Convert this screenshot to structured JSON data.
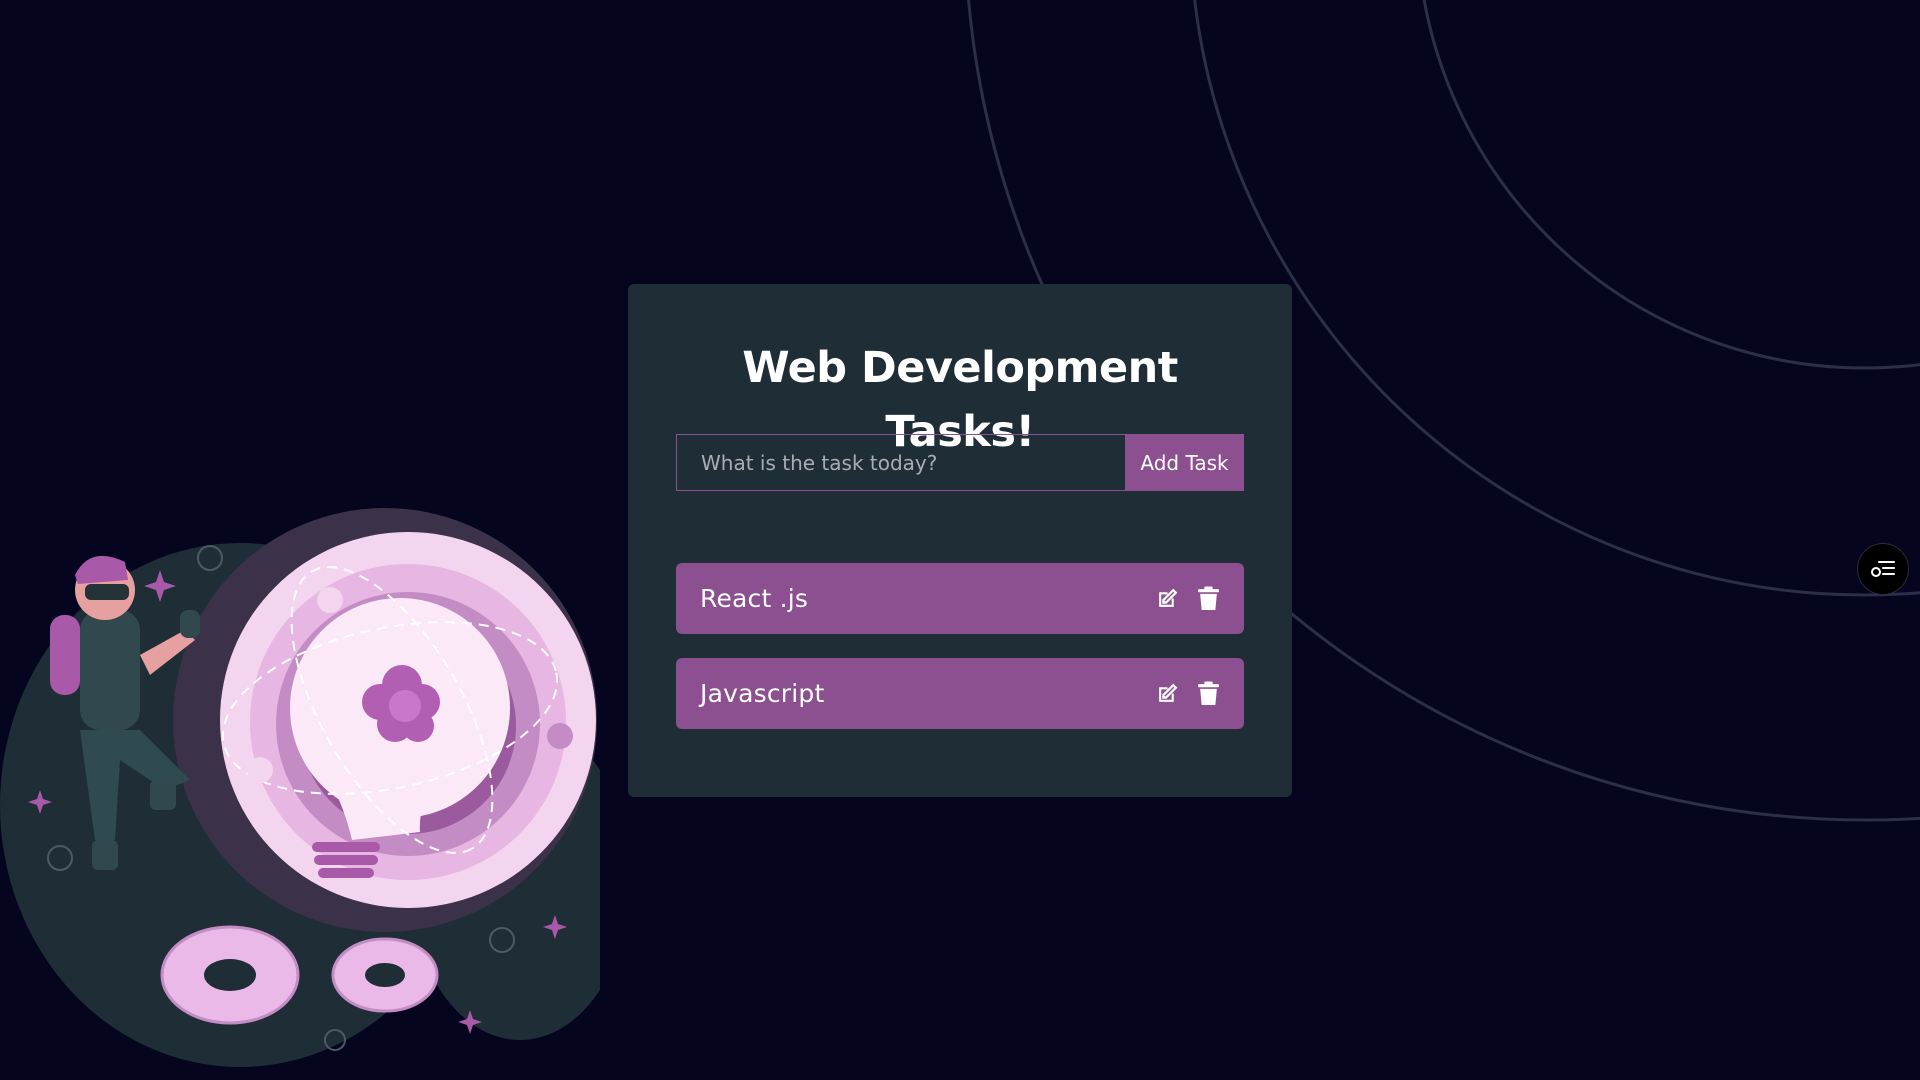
{
  "app": {
    "title": "Web Development Tasks!"
  },
  "form": {
    "input_value": "",
    "input_placeholder": "What is the task today?",
    "submit_label": "Add Task"
  },
  "tasks": [
    {
      "text": "React .js",
      "edit_icon": "edit-icon",
      "delete_icon": "trash-icon"
    },
    {
      "text": "Javascript",
      "edit_icon": "edit-icon",
      "delete_icon": "trash-icon"
    }
  ],
  "side_button": {
    "icon": "task-list-icon"
  },
  "colors": {
    "background": "#050520",
    "card": "#1f2d36",
    "accent": "#8c4f8f",
    "text": "#ffffff"
  }
}
